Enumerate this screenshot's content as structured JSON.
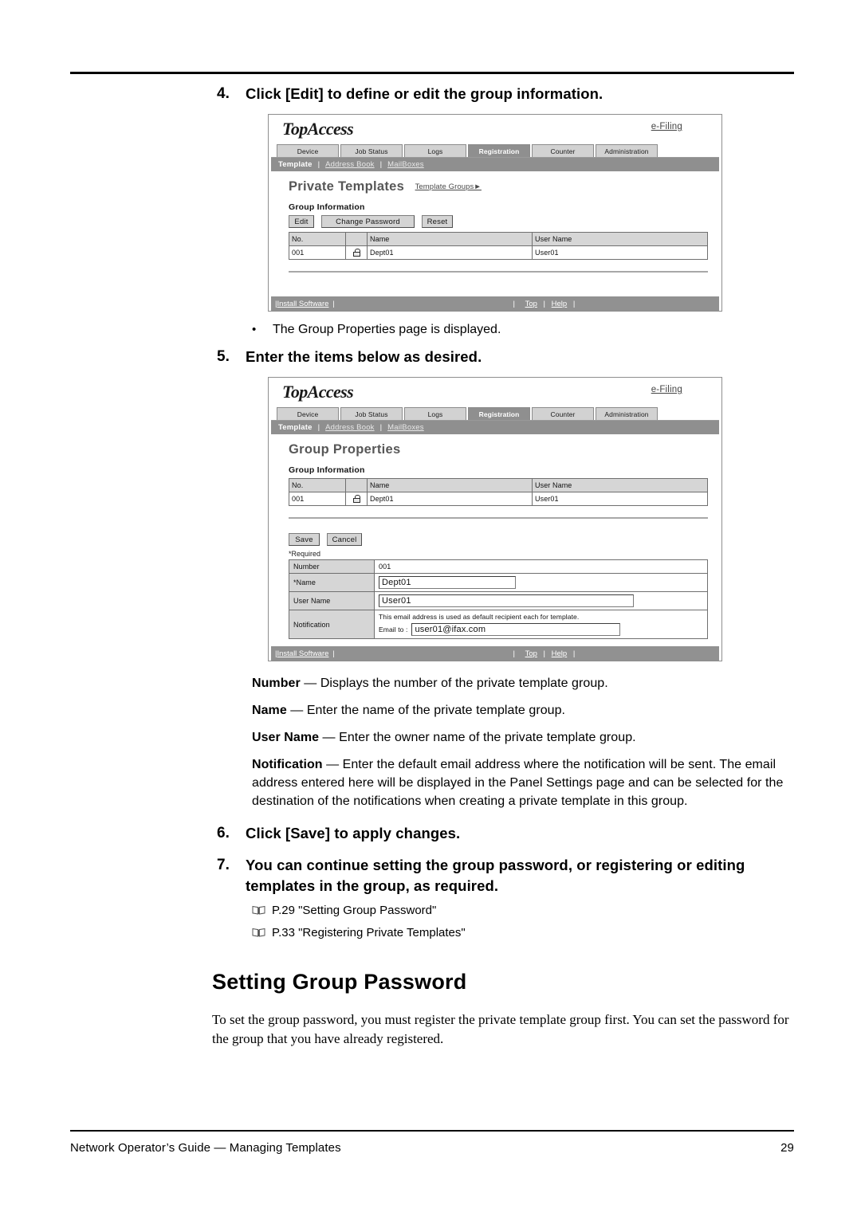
{
  "page": {
    "footer_left": "Network Operator’s Guide — Managing Templates",
    "footer_page_number": "29"
  },
  "steps": [
    {
      "number": "4.",
      "text": "Click [Edit] to define or edit the group information."
    },
    {
      "number": "5.",
      "text": "Enter the items below as desired."
    },
    {
      "number": "6.",
      "text": "Click [Save] to apply changes."
    },
    {
      "number": "7.",
      "text": "You can continue setting the group password, or registering or editing templates in the group, as required."
    }
  ],
  "bullet": {
    "marker": "•",
    "text": "The Group Properties page is displayed."
  },
  "screenshot1": {
    "brand": "TopAccess",
    "efiling_link": "e-Filing",
    "tabs": [
      {
        "label": "Device",
        "active": false
      },
      {
        "label": "Job Status",
        "active": false
      },
      {
        "label": "Logs",
        "active": false
      },
      {
        "label": "Registration",
        "active": true
      },
      {
        "label": "Counter",
        "active": false
      },
      {
        "label": "Administration",
        "active": false
      }
    ],
    "subnav": {
      "current": "Template",
      "separator": "|",
      "links": [
        "Address Book",
        "MailBoxes"
      ]
    },
    "page_title": "Private Templates",
    "page_title_link": "Template Groups►",
    "section_title": "Group Information",
    "buttons": [
      {
        "label": "Edit"
      },
      {
        "label": "Change Password"
      },
      {
        "label": "Reset"
      }
    ],
    "table": {
      "headers": [
        "No.",
        "",
        "Name",
        "User Name"
      ],
      "rows": [
        {
          "no": "001",
          "lock": "lock-icon",
          "name": "Dept01",
          "user_name": "User01"
        }
      ]
    },
    "footer": {
      "install": "Install Software",
      "top": "Top",
      "help": "Help",
      "pipe": "|"
    }
  },
  "screenshot2": {
    "brand": "TopAccess",
    "efiling_link": "e-Filing",
    "tabs": [
      {
        "label": "Device",
        "active": false
      },
      {
        "label": "Job Status",
        "active": false
      },
      {
        "label": "Logs",
        "active": false
      },
      {
        "label": "Registration",
        "active": true
      },
      {
        "label": "Counter",
        "active": false
      },
      {
        "label": "Administration",
        "active": false
      }
    ],
    "subnav": {
      "current": "Template",
      "separator": "|",
      "links": [
        "Address Book",
        "MailBoxes"
      ]
    },
    "page_title": "Group Properties",
    "section_title": "Group Information",
    "table": {
      "headers": [
        "No.",
        "",
        "Name",
        "User Name"
      ],
      "rows": [
        {
          "no": "001",
          "lock": "lock-icon",
          "name": "Dept01",
          "user_name": "User01"
        }
      ]
    },
    "buttons": [
      {
        "label": "Save"
      },
      {
        "label": "Cancel"
      }
    ],
    "required_note": "*Required",
    "form": {
      "number_label": "Number",
      "number_value": "001",
      "name_label": "*Name",
      "name_value": "Dept01",
      "user_name_label": "User Name",
      "user_name_value": "User01",
      "notification_label": "Notification",
      "notification_note": "This email address is used as default recipient each for template.",
      "email_to_label": "Email to :",
      "email_value": "user01@ifax.com"
    },
    "footer": {
      "install": "Install Software",
      "top": "Top",
      "help": "Help",
      "pipe": "|"
    }
  },
  "definitions": [
    {
      "term": "Number",
      "dash": " — ",
      "body": "Displays the number of the private template group."
    },
    {
      "term": "Name",
      "dash": " — ",
      "body": "Enter the name of the private template group."
    },
    {
      "term": "User Name",
      "dash": " — ",
      "body": "Enter the owner name of the private template group."
    },
    {
      "term": "Notification",
      "dash": " — ",
      "body": "Enter the default email address where the notification will be sent.  The email address entered here will be displayed in the Panel Settings page and can be selected for the destination of the notifications when creating a private template in this group."
    }
  ],
  "references": [
    {
      "text": "P.29 \"Setting Group Password\""
    },
    {
      "text": "P.33 \"Registering Private Templates\""
    }
  ],
  "section": {
    "heading": "Setting Group Password",
    "paragraph": "To set the group password, you must register the private template group first.  You can set the password for the group that you have already registered."
  }
}
